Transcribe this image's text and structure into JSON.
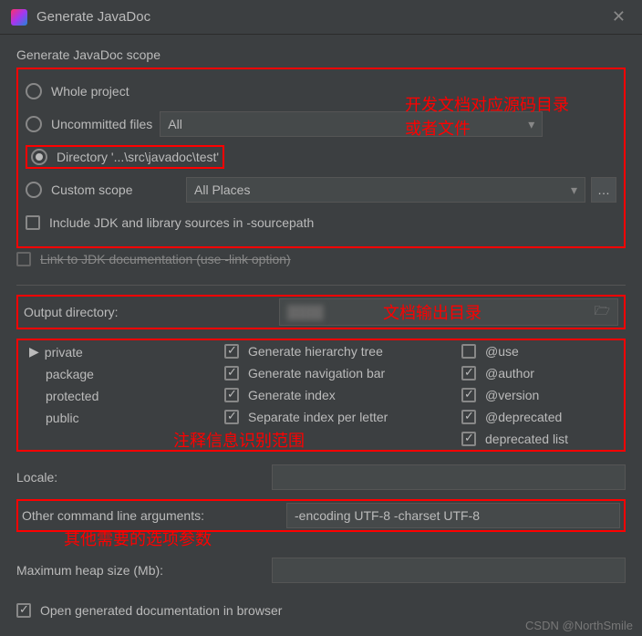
{
  "titlebar": {
    "title": "Generate JavaDoc"
  },
  "scope": {
    "label": "Generate JavaDoc scope",
    "whole": "Whole project",
    "uncommitted": "Uncommitted files",
    "uncommitted_select": "All",
    "directory": "Directory '...\\src\\javadoc\\test'",
    "custom": "Custom scope",
    "custom_select": "All Places",
    "include_jdk": "Include JDK and library sources in -sourcepath",
    "link_jdk": "Link to JDK documentation (use -link option)"
  },
  "annotations": {
    "scope1": "开发文档对应源码目录",
    "scope2": "或者文件",
    "output": "文档输出目录",
    "visibility": "注释信息识别范围",
    "cmd": "其他需要的选项参数"
  },
  "output": {
    "label": "Output directory:",
    "value": ""
  },
  "visibility": {
    "private": "private",
    "package": "package",
    "protected": "protected",
    "public": "public"
  },
  "options_mid": {
    "hierarchy": "Generate hierarchy tree",
    "navbar": "Generate navigation bar",
    "index": "Generate index",
    "sep_index": "Separate index per letter"
  },
  "options_right": {
    "use": "@use",
    "author": "@author",
    "version": "@version",
    "deprecated": "@deprecated",
    "deprecated_list": "deprecated list"
  },
  "locale": {
    "label": "Locale:",
    "value": ""
  },
  "cmd": {
    "label": "Other command line arguments:",
    "value": "-encoding UTF-8 -charset UTF-8"
  },
  "heap": {
    "label": "Maximum heap size (Mb):",
    "value": ""
  },
  "open_browser": "Open generated documentation in browser",
  "watermark": "CSDN @NorthSmile"
}
